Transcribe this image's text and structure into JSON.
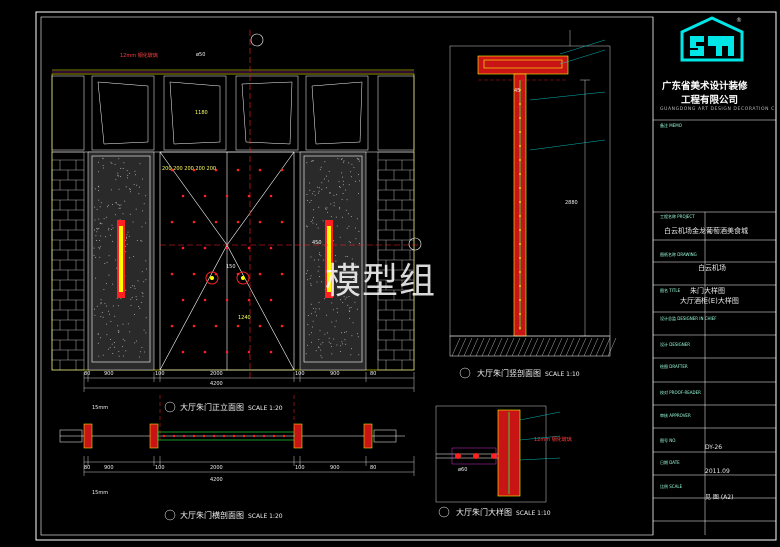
{
  "watermark": "模型组",
  "company": {
    "name_line1": "广东省美术设计装修",
    "name_line2": "工程有限公司",
    "name_en": "GUANGDONG ART DESIGN DECORATION C",
    "logo_mark": "®"
  },
  "title_block": {
    "memo_label": "备注\nMEMO",
    "project_label": "工程名称\nPROJECT",
    "project_value": "白云机场金龙葡萄酒美食城",
    "drawing_label": "图纸名称\nDRAWING",
    "drawing_value": "白云机场",
    "title_label": "图名\nTITLE",
    "title_value_1": "朱门大样图",
    "title_value_2": "大厅酒柜(E)大样图",
    "designer_in_chief_label": "设计总监\nDESIGNER IN CHIEF",
    "designer_label": "设计\nDESIGNER",
    "drafter_label": "绘图\nDRAFTER",
    "proof_reader_label": "校对\nPROOF-READER",
    "approver_label": "审核\nAPPROVER",
    "no_label": "图号\nNO.",
    "no_value": "DY-26",
    "date_label": "日期\nDATE",
    "date_value": "2011.09",
    "scale_label": "比例\nSCALE",
    "scale_value": "见 图 (A2)"
  },
  "captions": {
    "elevation": {
      "num": "1",
      "text": "大厅朱门正立面图",
      "scale": "SCALE  1:20"
    },
    "section_v": {
      "num": "1",
      "text": "大厅朱门竖剖面图",
      "scale": "SCALE  1:10"
    },
    "section_h": {
      "num": "2",
      "text": "大厅朱门横剖面图",
      "scale": "SCALE  1:20"
    },
    "detail": {
      "num": "2",
      "text": "大厅朱门大样图",
      "scale": "SCALE  1:10"
    }
  },
  "dims": {
    "top_12mm": "12mm 钢化玻璃",
    "phi50": "ø50",
    "d200s": "200 200 200 200 200",
    "d450": "450",
    "d150": "150",
    "d1240": "1240",
    "d1180": "1180",
    "bottom_row": [
      "80",
      "900",
      "100",
      "2000",
      "100",
      "900",
      "80"
    ],
    "total": "4200",
    "d15mm": "15mm",
    "d2880": "2880",
    "d12mm_detail": "12mm 钢化玻璃",
    "phi60": "ø60",
    "d45": "45"
  },
  "colors": {
    "frame": "#ffffff",
    "cyan": "#00e5e5",
    "red": "#ff2020",
    "yellow": "#ffff00",
    "green": "#20ff40",
    "magenta": "#ff40ff",
    "door_red": "#c81414"
  }
}
